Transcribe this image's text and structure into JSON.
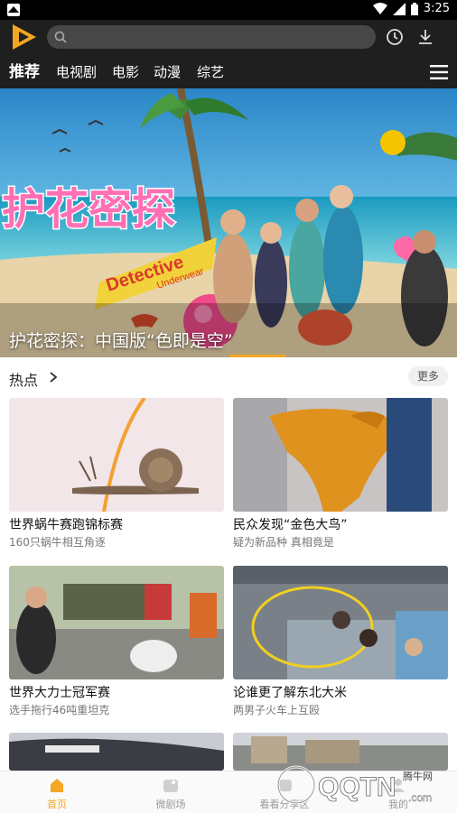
{
  "status_bar": {
    "time": "3:25"
  },
  "header": {
    "search_placeholder": "",
    "history_icon": "clock-icon",
    "download_icon": "download-icon"
  },
  "nav_tabs": [
    {
      "label": "推荐",
      "active": true
    },
    {
      "label": "电视剧"
    },
    {
      "label": "电影"
    },
    {
      "label": "动漫"
    },
    {
      "label": "综艺"
    }
  ],
  "banner": {
    "caption": "护花密探：中国版“色即是空”",
    "poster_title": "护花密探",
    "poster_subtitle_1": "Detective",
    "poster_subtitle_2": "Underwear"
  },
  "section": {
    "title": "热点",
    "more_label": "更多"
  },
  "cards": [
    {
      "title": "世界蜗牛赛跑锦标赛",
      "subtitle": "160只蜗牛相互角逐"
    },
    {
      "title": "民众发现“金色大鸟”",
      "subtitle": "疑为新品种 真相竟是"
    },
    {
      "title": "世界大力士冠军赛",
      "subtitle": "选手拖行46吨重坦克"
    },
    {
      "title": "论谁更了解东北大米",
      "subtitle": "两男子火车上互殴"
    }
  ],
  "bottom_nav": [
    {
      "label": "首页",
      "active": true
    },
    {
      "label": "微剧场"
    },
    {
      "label": "看看分享区"
    },
    {
      "label": "我的"
    }
  ],
  "watermark": {
    "text_main": "QQTN",
    "text_small": "腾牛网",
    "text_domain": ".com"
  },
  "colors": {
    "accent": "#f5a623",
    "top_bar": "#1f1f1f",
    "status_bar": "#000000"
  }
}
